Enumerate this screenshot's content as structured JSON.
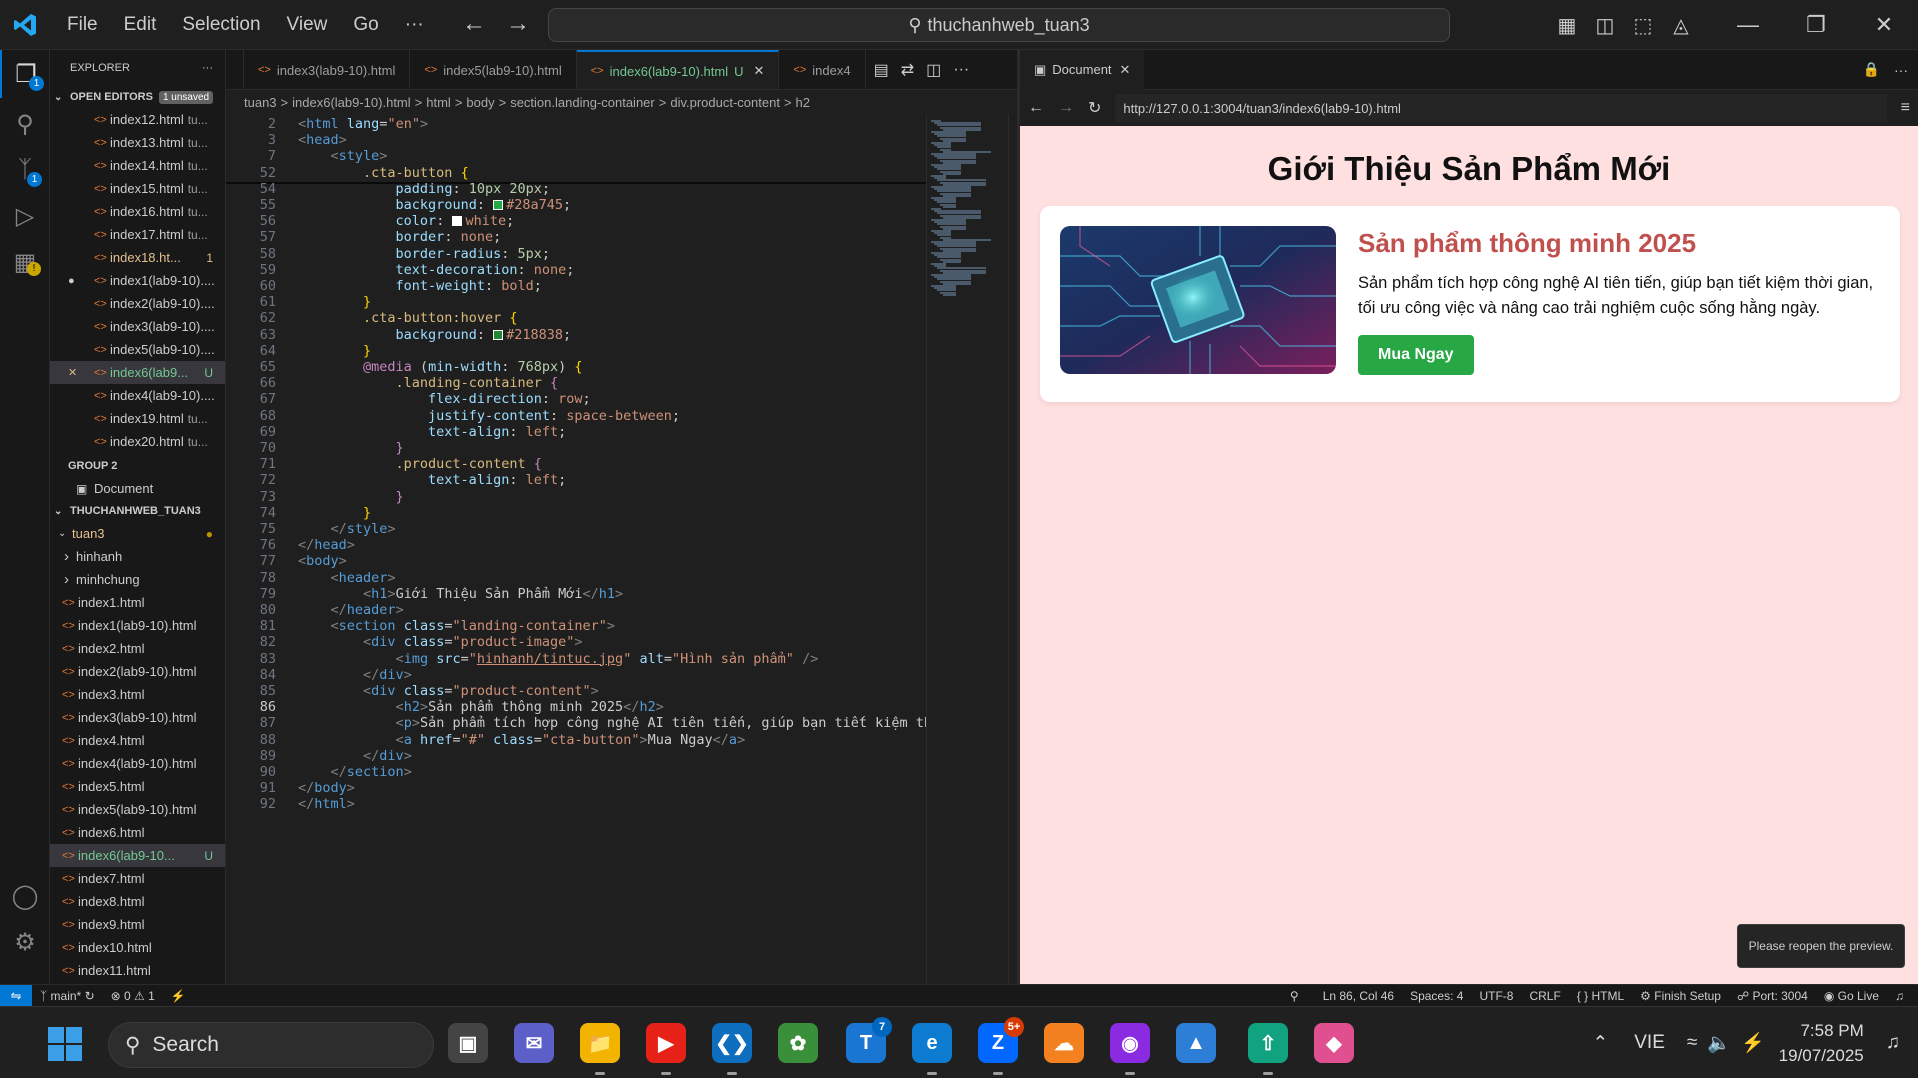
{
  "titlebar": {
    "menu": [
      "File",
      "Edit",
      "Selection",
      "View",
      "Go",
      "···"
    ],
    "search": "thuchanhweb_tuan3"
  },
  "sidebar": {
    "title": "EXPLORER",
    "open_editors_label": "OPEN EDITORS",
    "unsaved_badge": "1 unsaved",
    "open_editors": [
      {
        "name": "index12.html",
        "desc": "tu...",
        "state": ""
      },
      {
        "name": "index13.html",
        "desc": "tu...",
        "state": ""
      },
      {
        "name": "index14.html",
        "desc": "tu...",
        "state": ""
      },
      {
        "name": "index15.html",
        "desc": "tu...",
        "state": ""
      },
      {
        "name": "index16.html",
        "desc": "tu...",
        "state": ""
      },
      {
        "name": "index17.html",
        "desc": "tu...",
        "state": ""
      },
      {
        "name": "index18.ht...",
        "desc": "",
        "state": "1",
        "color": "yellow"
      },
      {
        "name": "index1(lab9-10)....",
        "desc": "",
        "state": "",
        "dot": true
      },
      {
        "name": "index2(lab9-10)....",
        "desc": "",
        "state": ""
      },
      {
        "name": "index3(lab9-10)....",
        "desc": "",
        "state": ""
      },
      {
        "name": "index5(lab9-10)....",
        "desc": "",
        "state": ""
      },
      {
        "name": "index6(lab9...",
        "desc": "",
        "state": "U",
        "color": "green",
        "selected": true,
        "close": true
      },
      {
        "name": "index4(lab9-10)....",
        "desc": "",
        "state": ""
      },
      {
        "name": "index19.html",
        "desc": "tu...",
        "state": ""
      },
      {
        "name": "index20.html",
        "desc": "tu...",
        "state": ""
      }
    ],
    "group2_label": "GROUP 2",
    "group2_item": "Document",
    "workspace_label": "THUCHANHWEB_TUAN3",
    "folder": "tuan3",
    "subfolders": [
      "hinhanh",
      "minhchung"
    ],
    "files": [
      {
        "name": "index1.html"
      },
      {
        "name": "index1(lab9-10).html"
      },
      {
        "name": "index2.html"
      },
      {
        "name": "index2(lab9-10).html"
      },
      {
        "name": "index3.html"
      },
      {
        "name": "index3(lab9-10).html"
      },
      {
        "name": "index4.html"
      },
      {
        "name": "index4(lab9-10).html"
      },
      {
        "name": "index5.html"
      },
      {
        "name": "index5(lab9-10).html"
      },
      {
        "name": "index6.html"
      },
      {
        "name": "index6(lab9-10...",
        "state": "U",
        "color": "green",
        "selected": true
      },
      {
        "name": "index7.html"
      },
      {
        "name": "index8.html"
      },
      {
        "name": "index9.html"
      },
      {
        "name": "index10.html"
      },
      {
        "name": "index11.html"
      }
    ]
  },
  "editor": {
    "tabs": [
      {
        "label": "index3(lab9-10).html"
      },
      {
        "label": "index5(lab9-10).html"
      },
      {
        "label": "index6(lab9-10).html",
        "state": "U",
        "active": true
      },
      {
        "label": "index4"
      }
    ],
    "breadcrumb": [
      "tuan3",
      ">",
      "index6(lab9-10).html",
      ">",
      "html",
      ">",
      "body",
      ">",
      "section.landing-container",
      ">",
      "div.product-content",
      ">",
      "h2"
    ],
    "current_line": "86",
    "lines": [
      {
        "n": "2",
        "html": "<span class='p'>&lt;</span><span class='t'>html</span> <span class='a'>lang</span>=<span class='s'>\"en\"</span><span class='p'>&gt;</span>"
      },
      {
        "n": "3",
        "html": "<span class='p'>&lt;</span><span class='t'>head</span><span class='p'>&gt;</span>"
      },
      {
        "n": "7",
        "html": "    <span class='p'>&lt;</span><span class='t'>style</span><span class='p'>&gt;</span>"
      },
      {
        "n": "52",
        "html": "        <span class='sel'>.cta-button</span> <span class='br'>{</span>"
      },
      {
        "n": "54",
        "html": "            <span class='a'>padding</span>: <span class='num'>10px 20px</span>;"
      },
      {
        "n": "55",
        "html": "            <span class='a'>background</span>: <span class='sw' style='background:#28a745'></span><span class='v'>#28a745</span>;"
      },
      {
        "n": "56",
        "html": "            <span class='a'>color</span>: <span class='sw' style='background:#fff'></span><span class='v'>white</span>;"
      },
      {
        "n": "57",
        "html": "            <span class='a'>border</span>: <span class='v'>none</span>;"
      },
      {
        "n": "58",
        "html": "            <span class='a'>border-radius</span>: <span class='num'>5px</span>;"
      },
      {
        "n": "59",
        "html": "            <span class='a'>text-decoration</span>: <span class='v'>none</span>;"
      },
      {
        "n": "60",
        "html": "            <span class='a'>font-weight</span>: <span class='v'>bold</span>;"
      },
      {
        "n": "61",
        "html": "        <span class='br'>}</span>"
      },
      {
        "n": "62",
        "html": "        <span class='sel'>.cta-button:hover</span> <span class='br'>{</span>"
      },
      {
        "n": "63",
        "html": "            <span class='a'>background</span>: <span class='sw' style='background:#218838'></span><span class='v'>#218838</span>;"
      },
      {
        "n": "64",
        "html": "        <span class='br'>}</span>"
      },
      {
        "n": "65",
        "html": "        <span class='at'>@media</span> (<span class='a'>min-width</span>: <span class='num'>768px</span>) <span class='br'>{</span>"
      },
      {
        "n": "66",
        "html": "            <span class='sel'>.landing-container</span> <span class='at'>{</span>"
      },
      {
        "n": "67",
        "html": "                <span class='a'>flex-direction</span>: <span class='v'>row</span>;"
      },
      {
        "n": "68",
        "html": "                <span class='a'>justify-content</span>: <span class='v'>space-between</span>;"
      },
      {
        "n": "69",
        "html": "                <span class='a'>text-align</span>: <span class='v'>left</span>;"
      },
      {
        "n": "70",
        "html": "            <span class='at'>}</span>"
      },
      {
        "n": "71",
        "html": "            <span class='sel'>.product-content</span> <span class='at'>{</span>"
      },
      {
        "n": "72",
        "html": "                <span class='a'>text-align</span>: <span class='v'>left</span>;"
      },
      {
        "n": "73",
        "html": "            <span class='at'>}</span>"
      },
      {
        "n": "74",
        "html": "        <span class='br'>}</span>"
      },
      {
        "n": "75",
        "html": "    <span class='p'>&lt;/</span><span class='t'>style</span><span class='p'>&gt;</span>"
      },
      {
        "n": "76",
        "html": "<span class='p'>&lt;/</span><span class='t'>head</span><span class='p'>&gt;</span>"
      },
      {
        "n": "77",
        "html": "<span class='p'>&lt;</span><span class='t'>body</span><span class='p'>&gt;</span>"
      },
      {
        "n": "78",
        "html": "    <span class='p'>&lt;</span><span class='t'>header</span><span class='p'>&gt;</span>"
      },
      {
        "n": "79",
        "html": "        <span class='p'>&lt;</span><span class='t'>h1</span><span class='p'>&gt;</span>Giới Thiệu Sản Phẩm Mới<span class='p'>&lt;/</span><span class='t'>h1</span><span class='p'>&gt;</span>"
      },
      {
        "n": "80",
        "html": "    <span class='p'>&lt;/</span><span class='t'>header</span><span class='p'>&gt;</span>"
      },
      {
        "n": "81",
        "html": "    <span class='p'>&lt;</span><span class='t'>section</span> <span class='a'>class</span>=<span class='s'>\"landing-container\"</span><span class='p'>&gt;</span>"
      },
      {
        "n": "82",
        "html": "        <span class='p'>&lt;</span><span class='t'>div</span> <span class='a'>class</span>=<span class='s'>\"product-image\"</span><span class='p'>&gt;</span>"
      },
      {
        "n": "83",
        "html": "            <span class='p'>&lt;</span><span class='t'>img</span> <span class='a'>src</span>=<span class='s'>\"<u>hinhanh/tintuc.jpg</u>\"</span> <span class='a'>alt</span>=<span class='s'>\"Hình sản phẩm\"</span> <span class='p'>/&gt;</span>"
      },
      {
        "n": "84",
        "html": "        <span class='p'>&lt;/</span><span class='t'>div</span><span class='p'>&gt;</span>"
      },
      {
        "n": "85",
        "html": "        <span class='p'>&lt;</span><span class='t'>div</span> <span class='a'>class</span>=<span class='s'>\"product-content\"</span><span class='p'>&gt;</span>"
      },
      {
        "n": "86",
        "html": "            <span class='p'>&lt;</span><span class='t'>h2</span><span class='p'>&gt;</span>Sản phẩm thông minh 2025<span class='p'>&lt;/</span><span class='t'>h2</span><span class='p'>&gt;</span>"
      },
      {
        "n": "87",
        "html": "            <span class='p'>&lt;</span><span class='t'>p</span><span class='p'>&gt;</span>Sản phẩm tích hợp công nghệ AI tiên tiến, giúp bạn tiết kiệm th"
      },
      {
        "n": "88",
        "html": "            <span class='p'>&lt;</span><span class='t'>a</span> <span class='a'>href</span>=<span class='s'>\"#\"</span> <span class='a'>class</span>=<span class='s'>\"cta-button\"</span><span class='p'>&gt;</span>Mua Ngay<span class='p'>&lt;/</span><span class='t'>a</span><span class='p'>&gt;</span>"
      },
      {
        "n": "89",
        "html": "        <span class='p'>&lt;/</span><span class='t'>div</span><span class='p'>&gt;</span>"
      },
      {
        "n": "90",
        "html": "    <span class='p'>&lt;/</span><span class='t'>section</span><span class='p'>&gt;</span>"
      },
      {
        "n": "91",
        "html": "<span class='p'>&lt;/</span><span class='t'>body</span><span class='p'>&gt;</span>"
      },
      {
        "n": "92",
        "html": "<span class='p'>&lt;/</span><span class='t'>html</span><span class='p'>&gt;</span>"
      }
    ]
  },
  "preview": {
    "tab_label": "Document",
    "url": "http://127.0.0.1:3004/tuan3/index6(lab9-10).html",
    "page_title": "Giới Thiệu Sản Phẩm Mới",
    "product_title": "Sản phẩm thông minh 2025",
    "product_desc": "Sản phẩm tích hợp công nghệ AI tiên tiến, giúp bạn tiết kiệm thời gian, tối ưu công việc và nâng cao trải nghiệm cuộc sống hằng ngày.",
    "cta_label": "Mua Ngay",
    "toast": "Please reopen the preview."
  },
  "statusbar": {
    "branch": "main*",
    "errors": "0",
    "warnings": "1",
    "position": "Ln 86, Col 46",
    "spaces": "Spaces: 4",
    "encoding": "UTF-8",
    "eol": "CRLF",
    "language": "HTML",
    "finish_setup": "Finish Setup",
    "port": "Port: 3004",
    "go_live": "Go Live"
  },
  "taskbar": {
    "search": "Search",
    "badge_teams": "7",
    "badge_zalo": "5+",
    "lang": "VIE",
    "time": "7:58 PM",
    "date": "19/07/2025"
  },
  "colors": {
    "accent": "#0078d4",
    "cta": "#28a745",
    "product_title": "#c0504d",
    "preview_bg": "#ffe0e0"
  }
}
